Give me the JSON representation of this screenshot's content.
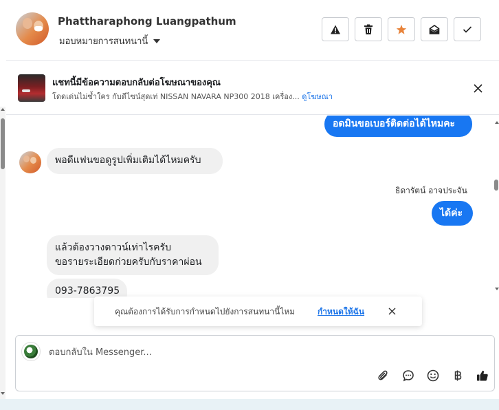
{
  "header": {
    "user_name": "Phattharaphong Luangpathum",
    "assign_label": "มอบหมายการสนทนานี้"
  },
  "ad_banner": {
    "title": "แชทนี้มีข้อความตอบกลับต่อโฆษณาของคุณ",
    "subtitle": "โดดเด่นไม่ซ้ำใคร กับดีไซน์สุดเท่ NISSAN NAVARA NP300 2018 เครื่อง...",
    "link": "ดูโฆษณา"
  },
  "messages": [
    {
      "direction": "outgoing",
      "text": "อดมินขอเบอร์ติดต่อได้ไหมคะ"
    },
    {
      "direction": "incoming",
      "text": "พอดีแฟนขอดูรูปเพิ่มเติมได้ไหมครับ"
    },
    {
      "sender": "ธิดารัตน์ อาจประจัน"
    },
    {
      "direction": "outgoing",
      "text": "ได้ค่ะ"
    },
    {
      "direction": "incoming",
      "line1": "แล้วต้องวางดาวน์เท่าไรครับ",
      "line2": "ขอรายระเอียดก่วยครับกับราคาผ่อน"
    },
    {
      "direction": "incoming",
      "text": "093-7863795"
    }
  ],
  "toast": {
    "text": "คุณต้องการได้รับการกำหนดไปยังการสนทนานี้ไหม",
    "link": "กำหนดให้ฉัน"
  },
  "composer": {
    "placeholder": "ตอบกลับใน Messenger..."
  },
  "colors": {
    "outgoing_bubble": "#1877f2",
    "incoming_bubble": "#f0f0f0",
    "star_accent": "#e8833a",
    "link": "#1a73e8"
  },
  "icons": [
    "warning-icon",
    "trash-icon",
    "star-icon",
    "envelope-open-icon",
    "check-icon",
    "close-icon",
    "paperclip-icon",
    "chat-bubble-icon",
    "smiley-icon",
    "baht-icon",
    "thumbs-up-icon"
  ]
}
